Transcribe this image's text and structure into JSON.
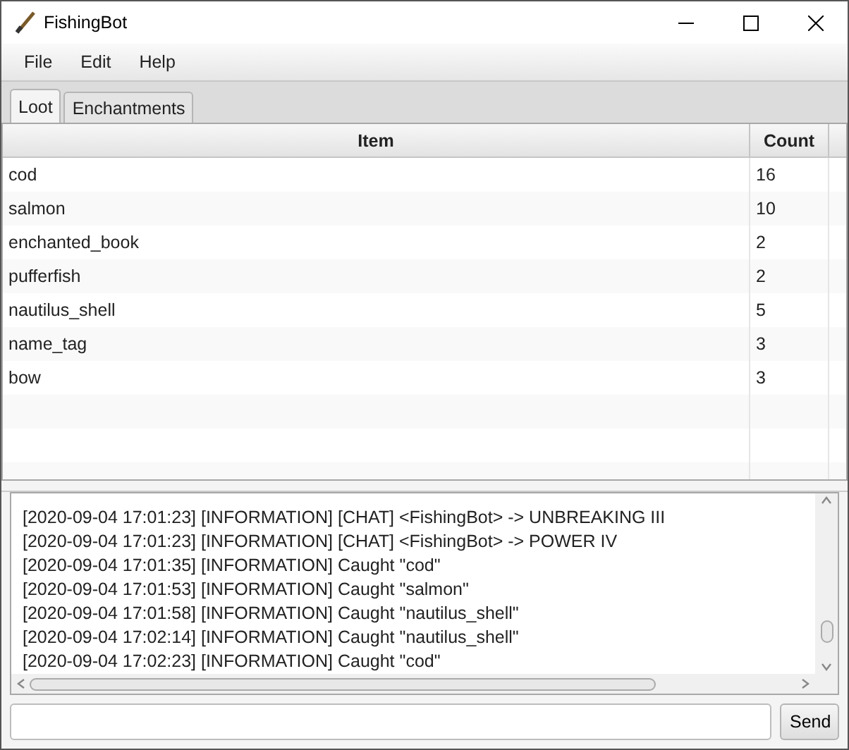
{
  "window": {
    "title": "FishingBot"
  },
  "menu": [
    "File",
    "Edit",
    "Help"
  ],
  "tabs": [
    {
      "label": "Loot",
      "selected": true
    },
    {
      "label": "Enchantments",
      "selected": false
    }
  ],
  "table": {
    "columns": [
      "Item",
      "Count"
    ],
    "rows": [
      {
        "item": "cod",
        "count": "16"
      },
      {
        "item": "salmon",
        "count": "10"
      },
      {
        "item": "enchanted_book",
        "count": "2"
      },
      {
        "item": "pufferfish",
        "count": "2"
      },
      {
        "item": "nautilus_shell",
        "count": "5"
      },
      {
        "item": "name_tag",
        "count": "3"
      },
      {
        "item": "bow",
        "count": "3"
      }
    ]
  },
  "log": [
    "[2020-09-04 17:01:23] [INFORMATION] [CHAT] <FishingBot> -> UNBREAKING III",
    "[2020-09-04 17:01:23] [INFORMATION] [CHAT] <FishingBot> -> POWER IV",
    "[2020-09-04 17:01:35] [INFORMATION] Caught \"cod\"",
    "[2020-09-04 17:01:53] [INFORMATION] Caught \"salmon\"",
    "[2020-09-04 17:01:58] [INFORMATION] Caught \"nautilus_shell\"",
    "[2020-09-04 17:02:14] [INFORMATION] Caught \"nautilus_shell\"",
    "[2020-09-04 17:02:23] [INFORMATION] Caught \"cod\""
  ],
  "send_button": "Send"
}
